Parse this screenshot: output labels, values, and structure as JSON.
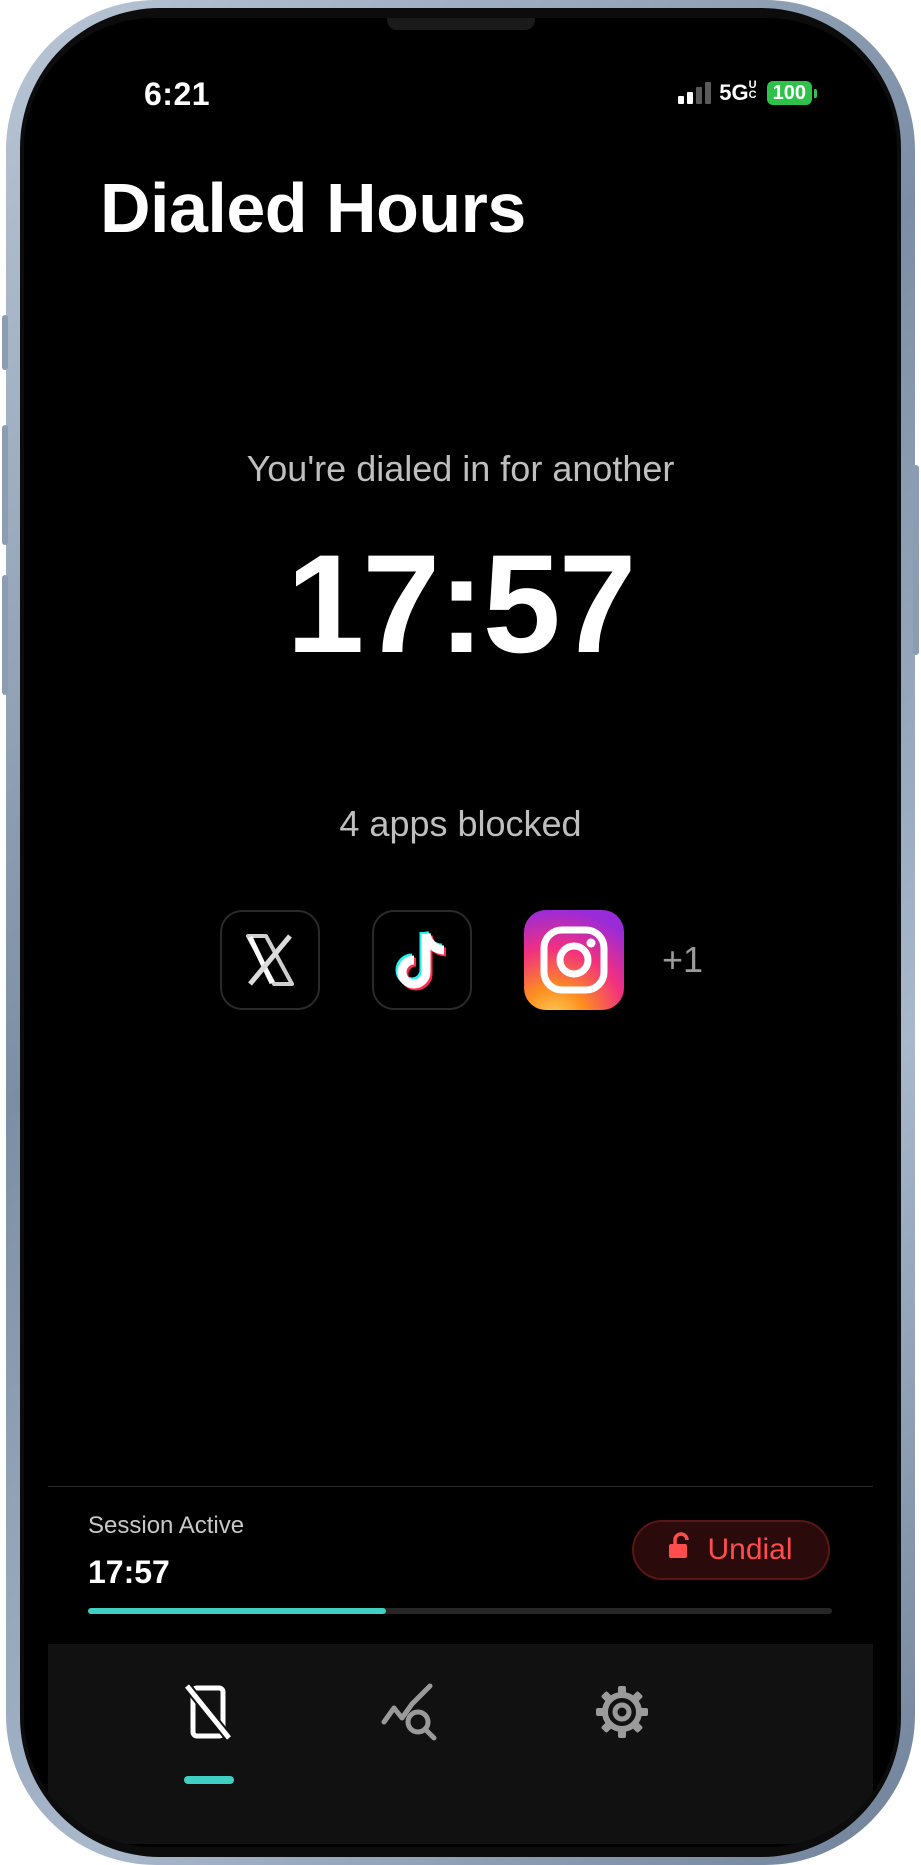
{
  "status_bar": {
    "time": "6:21",
    "network": "5G",
    "network_sup": "UC",
    "battery": "100",
    "signal_bars": 4,
    "signal_bars_filled": 2
  },
  "header": {
    "title": "Dialed Hours"
  },
  "main": {
    "subtitle": "You're dialed in for another",
    "timer": "17:57",
    "blocked_text": "4 apps blocked",
    "blocked_apps": [
      {
        "name": "X",
        "icon": "x-logo-icon"
      },
      {
        "name": "TikTok",
        "icon": "tiktok-logo-icon"
      },
      {
        "name": "Instagram",
        "icon": "instagram-logo-icon"
      }
    ],
    "more_apps": "+1"
  },
  "session": {
    "label": "Session Active",
    "time": "17:57",
    "button_label": "Undial",
    "button_icon": "unlock-icon",
    "progress_fraction": 0.4
  },
  "tabs": [
    {
      "icon": "phone-blocked-icon",
      "active": true
    },
    {
      "icon": "stats-search-icon",
      "active": false
    },
    {
      "icon": "gear-icon",
      "active": false
    }
  ],
  "colors": {
    "accent": "#3fcfc4",
    "danger": "#ff4d4d",
    "battery": "#2fc24a",
    "background": "#000000"
  }
}
